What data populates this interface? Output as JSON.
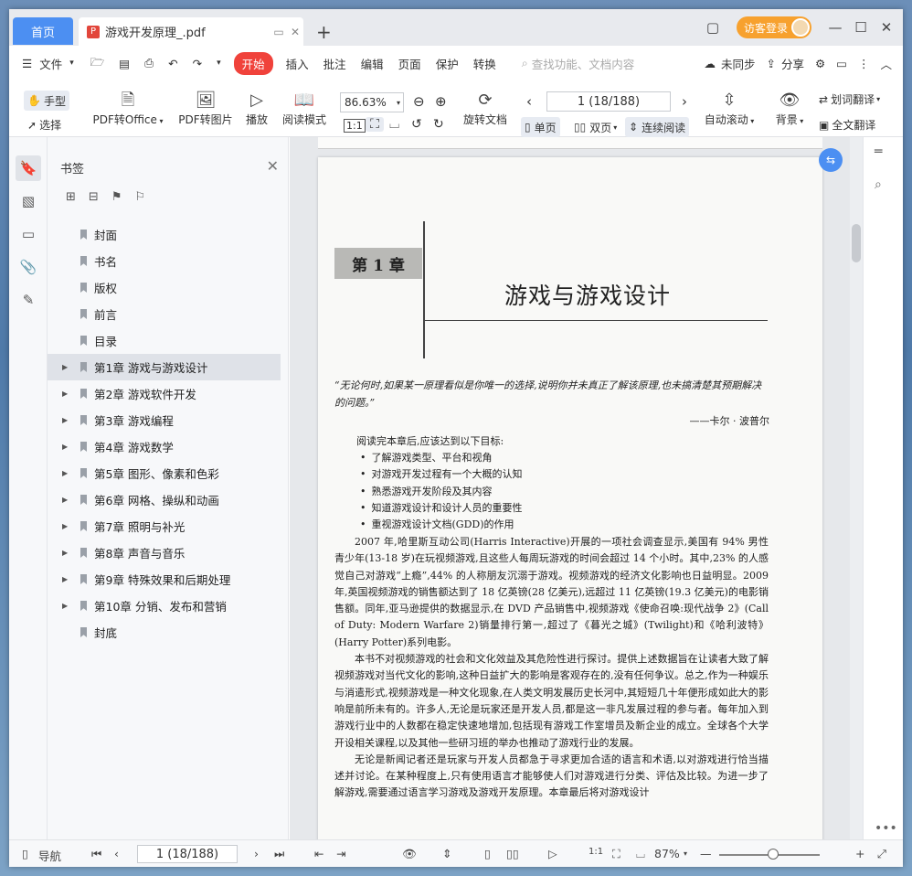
{
  "titlebar": {
    "home_tab": "首页",
    "doc_tab_title": "游戏开发原理_.pdf",
    "new_tab": "+",
    "login": "访客登录"
  },
  "menubar": {
    "file": "文件",
    "kaishi": "开始",
    "items": [
      "插入",
      "批注",
      "编辑",
      "页面",
      "保护",
      "转换"
    ],
    "search_placeholder": "查找功能、文档内容",
    "sync": "未同步",
    "share": "分享"
  },
  "toolbar": {
    "hand": "手型",
    "select": "选择",
    "pdf_to_office": "PDF转Office",
    "pdf_to_image": "PDF转图片",
    "play": "播放",
    "read_mode": "阅读模式",
    "zoom": "86.63%",
    "rotate_doc": "旋转文档",
    "page_indicator": "1 (18/188)",
    "single_page": "单页",
    "double_page": "双页",
    "continuous": "连续阅读",
    "auto_scroll": "自动滚动",
    "background": "背景",
    "word_translate": "划词翻译",
    "full_translate": "全文翻译"
  },
  "bookmarks": {
    "title": "书签",
    "items": [
      {
        "label": "封面",
        "expandable": false
      },
      {
        "label": "书名",
        "expandable": false
      },
      {
        "label": "版权",
        "expandable": false
      },
      {
        "label": "前言",
        "expandable": false
      },
      {
        "label": "目录",
        "expandable": false
      },
      {
        "label": "第1章   游戏与游戏设计",
        "expandable": true,
        "selected": true
      },
      {
        "label": "第2章   游戏软件开发",
        "expandable": true
      },
      {
        "label": "第3章   游戏编程",
        "expandable": true
      },
      {
        "label": "第4章   游戏数学",
        "expandable": true
      },
      {
        "label": "第5章   图形、像素和色彩",
        "expandable": true
      },
      {
        "label": "第6章   网格、操纵和动画",
        "expandable": true
      },
      {
        "label": "第7章   照明与补光",
        "expandable": true
      },
      {
        "label": "第8章   声音与音乐",
        "expandable": true
      },
      {
        "label": "第9章   特殊效果和后期处理",
        "expandable": true
      },
      {
        "label": "第10章   分销、发布和营销",
        "expandable": true
      },
      {
        "label": "封底",
        "expandable": false
      }
    ]
  },
  "page": {
    "chapter_label": "第 1 章",
    "chapter_title": "游戏与游戏设计",
    "quote": "“无论何时,如果某一原理看似是你唯一的选择,说明你并未真正了解该原理,也未搞清楚其预期解决的问题。”",
    "quote_author": "——卡尔 · 波普尔",
    "goals_intro": "阅读完本章后,应该达到以下目标:",
    "goals": [
      "了解游戏类型、平台和视角",
      "对游戏开发过程有一个大概的认知",
      "熟悉游戏开发阶段及其内容",
      "知道游戏设计和设计人员的重要性",
      "重视游戏设计文档(GDD)的作用"
    ],
    "paragraphs": [
      "2007 年,哈里斯互动公司(Harris Interactive)开展的一项社会调查显示,美国有 94% 男性青少年(13-18 岁)在玩视频游戏,且这些人每周玩游戏的时间会超过 14 个小时。其中,23% 的人感觉自己对游戏“上瘾”,44% 的人称朋友沉溺于游戏。视频游戏的经济文化影响也日益明显。2009 年,英国视频游戏的销售额达到了 18 亿英镑(28 亿美元),远超过 11 亿英镑(19.3 亿美元)的电影销售额。同年,亚马逊提供的数据显示,在 DVD 产品销售中,视频游戏《使命召唤:现代战争 2》(Call of Duty: Modern Warfare 2)销量排行第一,超过了《暮光之城》(Twilight)和《哈利波特》(Harry Potter)系列电影。",
      "本书不对视频游戏的社会和文化效益及其危险性进行探讨。提供上述数据旨在让读者大致了解视频游戏对当代文化的影响,这种日益扩大的影响是客观存在的,没有任何争议。总之,作为一种娱乐与消遣形式,视频游戏是一种文化现象,在人类文明发展历史长河中,其短短几十年便形成如此大的影响是前所未有的。许多人,无论是玩家还是开发人员,都是这一非凡发展过程的参与者。每年加入到游戏行业中的人数都在稳定快速地增加,包括现有游戏工作室增员及新企业的成立。全球各个大学开设相关课程,以及其他一些研习班的举办也推动了游戏行业的发展。",
      "无论是新闻记者还是玩家与开发人员都急于寻求更加合适的语言和术语,以对游戏进行恰当描述并讨论。在某种程度上,只有使用语言才能够使人们对游戏进行分类、评估及比较。为进一步了解游戏,需要通过语言学习游戏及游戏开发原理。本章最后将对游戏设计"
    ]
  },
  "statusbar": {
    "nav": "导航",
    "page_indicator": "1 (18/188)",
    "zoom": "87%"
  }
}
